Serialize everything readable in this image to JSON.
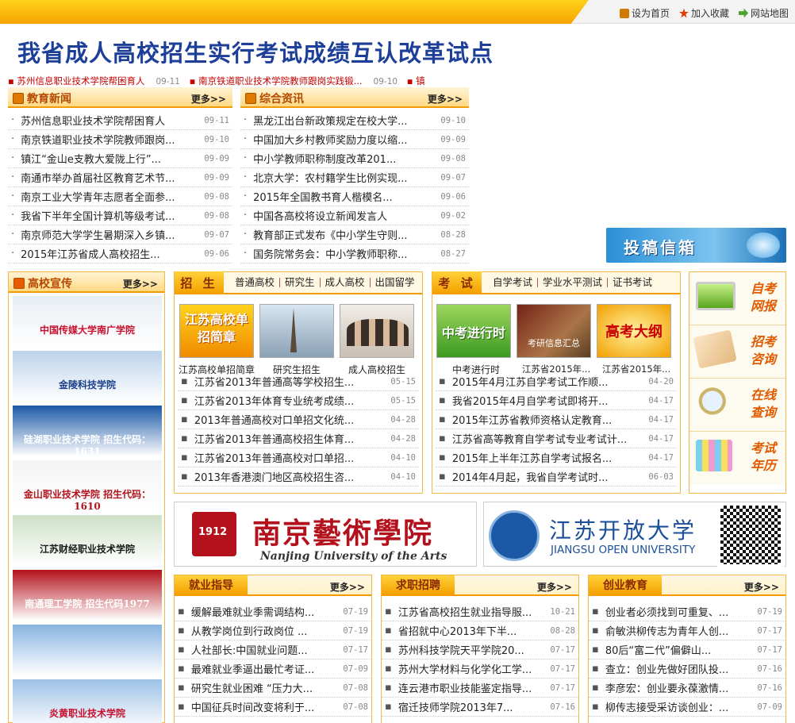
{
  "topbar": {
    "links": [
      {
        "label": "设为首页",
        "icon": "home-icon"
      },
      {
        "label": "加入收藏",
        "icon": "star-icon"
      },
      {
        "label": "网站地图",
        "icon": "map-icon"
      }
    ]
  },
  "headline": "我省成人高校招生实行考试成绩互认改革试点",
  "ticker": [
    {
      "text": "苏州信息职业技术学院帮困育人",
      "date": "09-11"
    },
    {
      "text": "南京铁道职业技术学院教师跟岗实践锻...",
      "date": "09-10"
    },
    {
      "text": "镇",
      "date": ""
    }
  ],
  "edu_news": {
    "title": "教育新闻",
    "more": "更多>>",
    "items": [
      {
        "text": "苏州信息职业技术学院帮困育人",
        "date": "09-11"
      },
      {
        "text": "南京铁道职业技术学院教师跟岗...",
        "date": "09-10"
      },
      {
        "text": "镇江“金山e支教大爱陇上行”...",
        "date": "09-09"
      },
      {
        "text": "南通市举办首届社区教育艺术节...",
        "date": "09-09"
      },
      {
        "text": "南京工业大学青年志愿者全面参...",
        "date": "09-08"
      },
      {
        "text": "我省下半年全国计算机等级考试...",
        "date": "09-08"
      },
      {
        "text": "南京师范大学学生暑期深入乡镇...",
        "date": "09-07"
      },
      {
        "text": "2015年江苏省成人高校招生...",
        "date": "09-06"
      }
    ]
  },
  "general_news": {
    "title": "综合资讯",
    "more": "更多>>",
    "items": [
      {
        "text": "黑龙江出台新政策规定在校大学...",
        "date": "09-10"
      },
      {
        "text": "中国加大乡村教师奖励力度以缩...",
        "date": "09-09"
      },
      {
        "text": "中小学教师职称制度改革201...",
        "date": "09-08"
      },
      {
        "text": "北京大学：农村籍学生比例实现...",
        "date": "09-07"
      },
      {
        "text": "2015年全国教书育人楷模名...",
        "date": "09-06"
      },
      {
        "text": "中国各高校将设立新闻发言人",
        "date": "09-02"
      },
      {
        "text": "教育部正式发布《中小学生守则...",
        "date": "08-28"
      },
      {
        "text": "国务院常务会：中小学教师职称...",
        "date": "08-27"
      }
    ]
  },
  "submit_banner": "投稿信箱",
  "college_promo": {
    "title": "高校宣传",
    "more": "更多>>",
    "items": [
      {
        "caption": "中国传媒大学南广学院",
        "color": "#c8102e",
        "bg": "#e8eef4"
      },
      {
        "caption": "金陵科技学院",
        "color": "#1a3f8c",
        "bg": "#bcd3ea"
      },
      {
        "caption": "硅湖职业技术学院  招生代码：1631",
        "color": "#ffffff",
        "bg": "#1b59a6"
      },
      {
        "caption": "金山职业技术学院  招生代码：1610",
        "color": "#b3121c",
        "bg": "#f4f4f4"
      },
      {
        "caption": "江苏财经职业技术学院",
        "color": "#1a1a1a",
        "bg": "#cfe0c7"
      },
      {
        "caption": "南通理工学院  招生代码1977",
        "color": "#ffffff",
        "bg": "#b3121c"
      },
      {
        "caption": "",
        "color": "#ffffff",
        "bg": "#88b4e0"
      },
      {
        "caption": "炎黄职业技术学院",
        "color": "#c8102e",
        "bg": "#9dc1e6"
      }
    ]
  },
  "admission": {
    "main_tab": "招 生",
    "tabs": [
      "普通高校",
      "研究生",
      "成人高校",
      "出国留学"
    ],
    "thumbs": [
      {
        "label": "江苏高校单招简章",
        "art": "江苏高校单招简章"
      },
      {
        "label": "研究生招生",
        "art": ""
      },
      {
        "label": "成人高校招生",
        "art": ""
      }
    ],
    "items": [
      {
        "text": "江苏省2013年普通高等学校招生...",
        "date": "05-15"
      },
      {
        "text": "江苏省2013年体育专业统考成绩...",
        "date": "05-15"
      },
      {
        "text": "2013年普通高校对口单招文化统...",
        "date": "04-28"
      },
      {
        "text": "江苏省2013年普通高校招生体育...",
        "date": "04-28"
      },
      {
        "text": "江苏省2013年普通高校对口单招...",
        "date": "04-10"
      },
      {
        "text": "2013年香港澳门地区高校招生咨...",
        "date": "04-10"
      }
    ]
  },
  "exam": {
    "main_tab": "考 试",
    "tabs": [
      "自学考试",
      "学业水平测试",
      "证书考试"
    ],
    "thumbs": [
      {
        "label": "中考进行时",
        "art": "中考进行时"
      },
      {
        "label": "江苏省2015年...",
        "art": "考研信息汇总"
      },
      {
        "label": "江苏省2015年...",
        "art": "高考大纲"
      }
    ],
    "items": [
      {
        "text": "2015年4月江苏自学考试工作顺...",
        "date": "04-20"
      },
      {
        "text": "我省2015年4月自学考试即将开...",
        "date": "04-17"
      },
      {
        "text": "2015年江苏省教师资格认定教育...",
        "date": "04-17"
      },
      {
        "text": "江苏省高等教育自学考试专业考试计...",
        "date": "04-17"
      },
      {
        "text": "2015年上半年江苏自学考试报名...",
        "date": "04-17"
      },
      {
        "text": "2014年4月起，我省自学考试时...",
        "date": "06-03"
      }
    ]
  },
  "side_promo": [
    {
      "label": "自考\n网报",
      "icon": "computer-icon"
    },
    {
      "label": "招考\n咨询",
      "icon": "scroll-icon"
    },
    {
      "label": "在线\n查询",
      "icon": "magnifier-icon"
    },
    {
      "label": "考试\n年历",
      "icon": "calendar-icon"
    }
  ],
  "banners": {
    "nua": {
      "cn": "南京藝術學院",
      "en": "Nanjing University of the Arts",
      "seal": "1912"
    },
    "jou": {
      "cn": "江苏开放大学",
      "en": "JIANGSU OPEN UNIVERSITY"
    }
  },
  "employment": {
    "title": "就业指导",
    "more": "更多>>",
    "items": [
      {
        "text": "缓解最难就业季需调结构...",
        "date": "07-19"
      },
      {
        "text": "从教学岗位到行政岗位 ...",
        "date": "07-19"
      },
      {
        "text": "人社部长:中国就业问题...",
        "date": "07-17"
      },
      {
        "text": "最难就业季逼出最忙考证...",
        "date": "07-09"
      },
      {
        "text": "研究生就业困难 “压力大...",
        "date": "07-08"
      },
      {
        "text": "中国征兵时间改变将利于...",
        "date": "07-08"
      }
    ]
  },
  "recruit": {
    "title": "求职招聘",
    "more": "更多>>",
    "items": [
      {
        "text": "江苏省高校招生就业指导服...",
        "date": "10-21"
      },
      {
        "text": "省招就中心2013年下半...",
        "date": "08-28"
      },
      {
        "text": "苏州科技学院天平学院20...",
        "date": "07-17"
      },
      {
        "text": "苏州大学材料与化学化工学...",
        "date": "07-17"
      },
      {
        "text": "连云港市职业技能鉴定指导...",
        "date": "07-17"
      },
      {
        "text": "宿迁技师学院2013年7...",
        "date": "07-16"
      }
    ]
  },
  "startup": {
    "title": "创业教育",
    "more": "更多>>",
    "items": [
      {
        "text": "创业者必须找到可重复、...",
        "date": "07-19"
      },
      {
        "text": "俞敏洪柳传志为青年人创...",
        "date": "07-17"
      },
      {
        "text": "80后“富二代”偏僻山...",
        "date": "07-17"
      },
      {
        "text": "查立：创业先做好团队投...",
        "date": "07-16"
      },
      {
        "text": "李彦宏：创业要永葆激情...",
        "date": "07-16"
      },
      {
        "text": "柳传志接受采访谈创业：...",
        "date": "07-09"
      }
    ]
  }
}
